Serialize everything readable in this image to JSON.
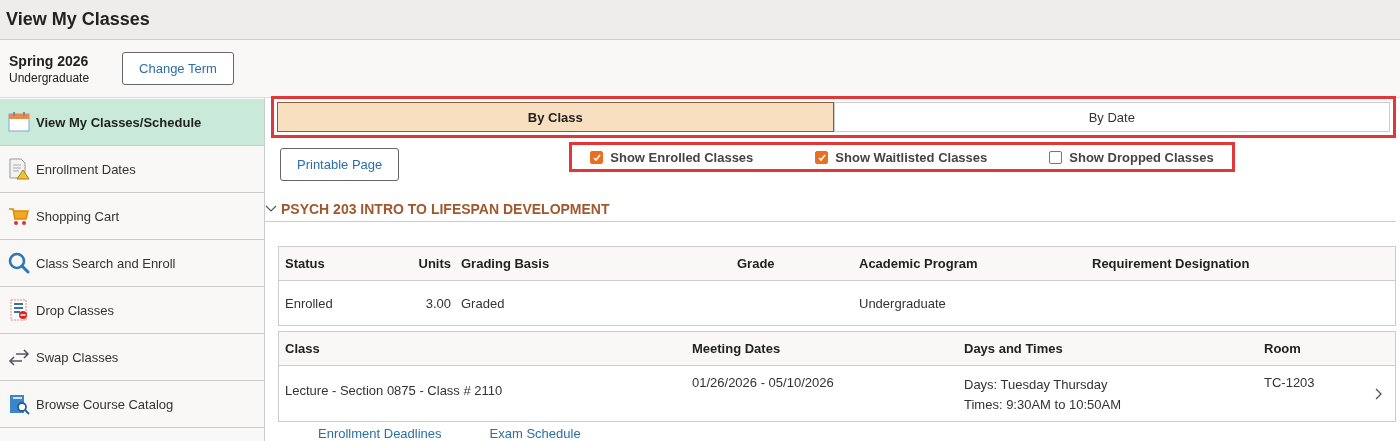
{
  "page_title": "View My Classes",
  "term": {
    "name": "Spring 2026",
    "career": "Undergraduate",
    "button": "Change Term"
  },
  "sidebar": {
    "items": [
      {
        "label": "View My Classes/Schedule",
        "kind": "calendar",
        "selected": true
      },
      {
        "label": "Enrollment Dates",
        "kind": "dates",
        "selected": false
      },
      {
        "label": "Shopping Cart",
        "kind": "cart",
        "selected": false
      },
      {
        "label": "Class Search and Enroll",
        "kind": "search",
        "selected": false
      },
      {
        "label": "Drop Classes",
        "kind": "drop",
        "selected": false
      },
      {
        "label": "Swap Classes",
        "kind": "swap",
        "selected": false
      },
      {
        "label": "Browse Course Catalog",
        "kind": "catalog",
        "selected": false
      }
    ]
  },
  "tabs": {
    "highlighted": true,
    "items": [
      {
        "label": "By Class",
        "selected": true
      },
      {
        "label": "By Date",
        "selected": false
      }
    ]
  },
  "printable_button": "Printable Page",
  "filters": {
    "highlighted": true,
    "items": [
      {
        "label": "Show Enrolled Classes",
        "checked": true
      },
      {
        "label": "Show Waitlisted Classes",
        "checked": true
      },
      {
        "label": "Show Dropped Classes",
        "checked": false
      }
    ]
  },
  "course": {
    "title": "PSYCH 203 INTRO TO LIFESPAN DEVELOPMENT",
    "expanded": true,
    "enrollment_table": {
      "columns": [
        "Status",
        "Units",
        "Grading Basis",
        "Grade",
        "Academic Program",
        "Requirement Designation"
      ],
      "rows": [
        [
          "Enrolled",
          "3.00",
          "Graded",
          "",
          "Undergraduate",
          ""
        ]
      ]
    },
    "meeting_table": {
      "columns": [
        "Class",
        "Meeting Dates",
        "Days and Times",
        "Room"
      ],
      "rows": [
        {
          "class": "Lecture - Section 0875 - Class # 2110",
          "dates": "01/26/2026 - 05/10/2026",
          "days": "Days: Tuesday Thursday",
          "times": "Times: 9:30AM to 10:50AM",
          "room": "TC-1203"
        }
      ]
    },
    "links": [
      "Enrollment Deadlines",
      "Exam Schedule"
    ]
  }
}
